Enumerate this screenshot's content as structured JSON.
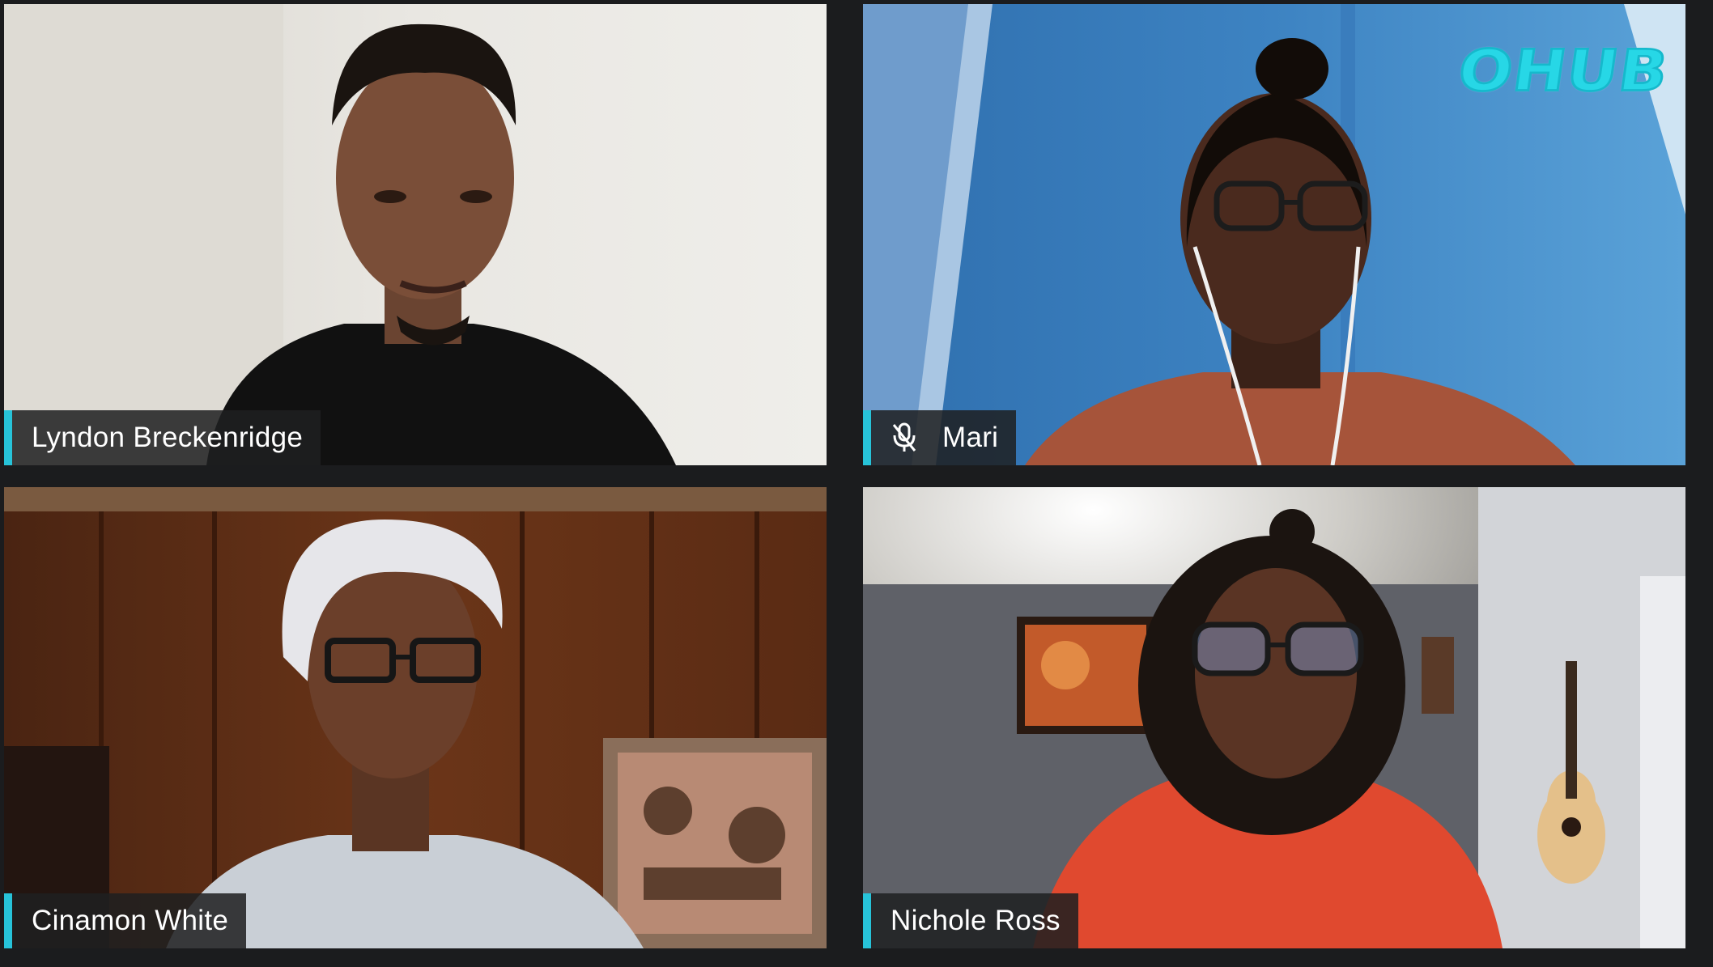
{
  "call": {
    "participants": [
      {
        "name": "Lyndon Breckenridge",
        "muted": false
      },
      {
        "name": "Mari",
        "muted": true
      },
      {
        "name": "Cinamon White",
        "muted": false
      },
      {
        "name": "Nichole Ross",
        "muted": false
      }
    ]
  },
  "branding": {
    "logo_text": "OHUB"
  },
  "colors": {
    "accent": "#27c3d9",
    "background": "#1b1c1e",
    "nameplate": "#1e1f21"
  },
  "icons": {
    "mute": "microphone-off-icon"
  }
}
